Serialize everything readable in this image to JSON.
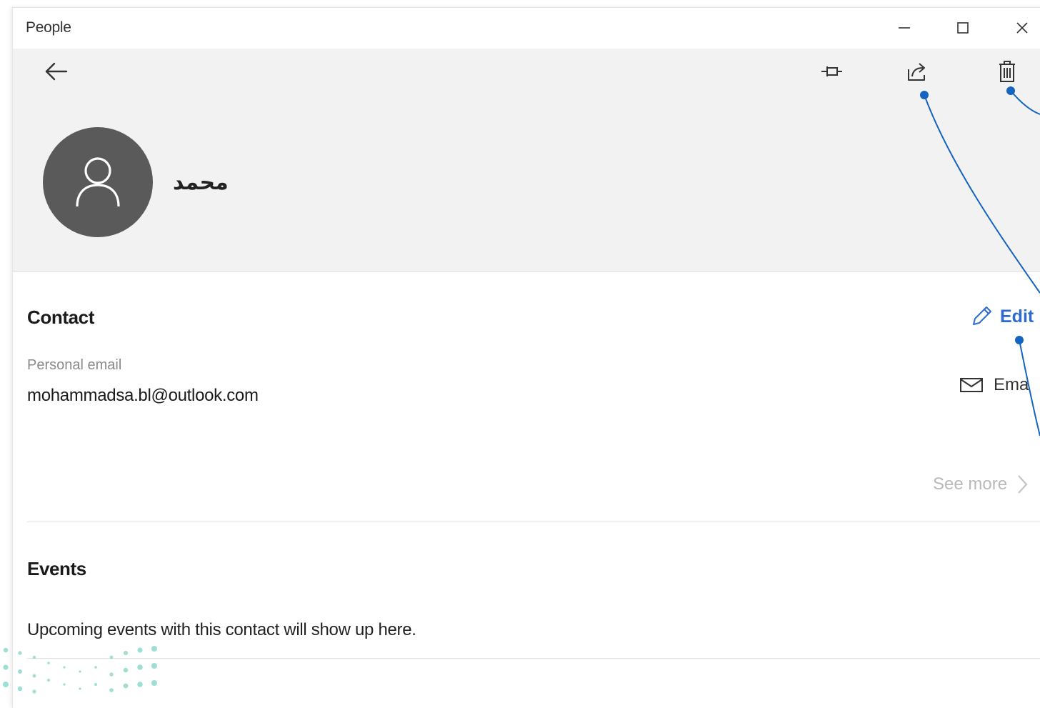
{
  "window": {
    "app_title": "People",
    "controls": [
      "minimize-icon",
      "maximize-icon",
      "close-icon"
    ]
  },
  "toolbar": {
    "back_icon": "back-arrow-icon",
    "actions": [
      "pin-icon",
      "share-icon",
      "delete-icon"
    ]
  },
  "profile": {
    "avatar_icon": "person-icon",
    "name": "محمد"
  },
  "contact": {
    "title": "Contact",
    "edit_label": "Edit",
    "email_label": "Personal email",
    "email_value": "mohammadsa.bl@outlook.com",
    "email_action_label": "Ema",
    "see_more_label": "See more"
  },
  "events": {
    "title": "Events",
    "empty_text": "Upcoming events with this contact will show up here."
  },
  "colors": {
    "accent": "#2e6bd1",
    "header_bg": "#f2f2f2",
    "avatar_bg": "#5a5a5a",
    "annotation": "#1565c0",
    "decor_dots": "#7fd3c4"
  }
}
